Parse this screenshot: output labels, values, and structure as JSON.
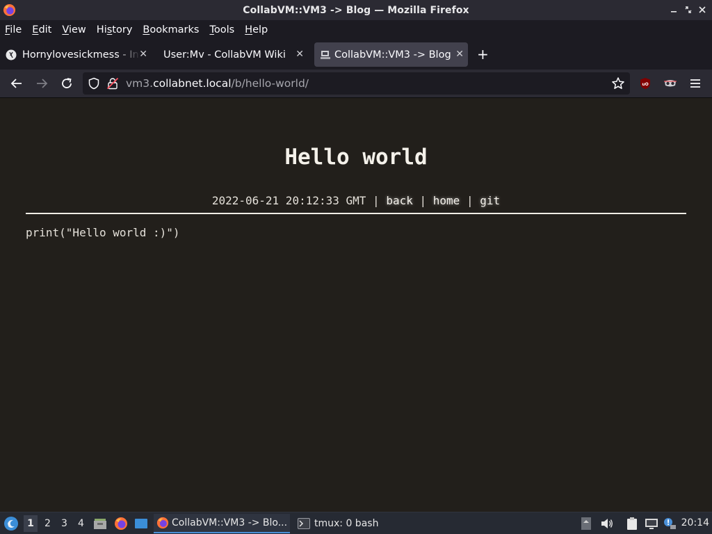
{
  "window": {
    "title": "CollabVM::VM3 -> Blog — Mozilla Firefox"
  },
  "menu": {
    "items": [
      {
        "label_ul": "F",
        "label_rest": "ile"
      },
      {
        "label_ul": "E",
        "label_rest": "dit"
      },
      {
        "label_ul": "V",
        "label_rest": "iew"
      },
      {
        "label_pre": "Hi",
        "label_ul": "s",
        "label_rest": "tory"
      },
      {
        "label_ul": "B",
        "label_rest": "ookmarks"
      },
      {
        "label_ul": "T",
        "label_rest": "ools"
      },
      {
        "label_ul": "H",
        "label_rest": "elp"
      }
    ]
  },
  "tabs": [
    {
      "label": "Hornylovesickmess - In",
      "active": false
    },
    {
      "label": "User:Mv - CollabVM Wiki",
      "active": false
    },
    {
      "label": "CollabVM::VM3 -> Blog",
      "active": true
    }
  ],
  "navbar": {
    "url_prefix": "vm3.",
    "url_host": "collabnet.local",
    "url_path": "/b/hello-world/"
  },
  "page": {
    "title": "Hello world",
    "date": "2022-06-21 20:12:33 GMT",
    "separator": "|",
    "links": {
      "back": "back",
      "home": "home",
      "git": "git"
    },
    "body": "print(\"Hello world :)\")"
  },
  "taskbar": {
    "workspaces": [
      "1",
      "2",
      "3",
      "4"
    ],
    "active_workspace": "1",
    "tasks": [
      {
        "label": "CollabVM::VM3 -> Blo...",
        "active": true
      },
      {
        "label": "tmux: 0 bash",
        "active": false
      }
    ],
    "clock": "20:14"
  },
  "colors": {
    "page_bg": "#221f1b",
    "browser_chrome": "#1c1b22",
    "toolbar": "#2b2a33",
    "active_tab": "#42414d",
    "taskbar": "#262a33"
  }
}
